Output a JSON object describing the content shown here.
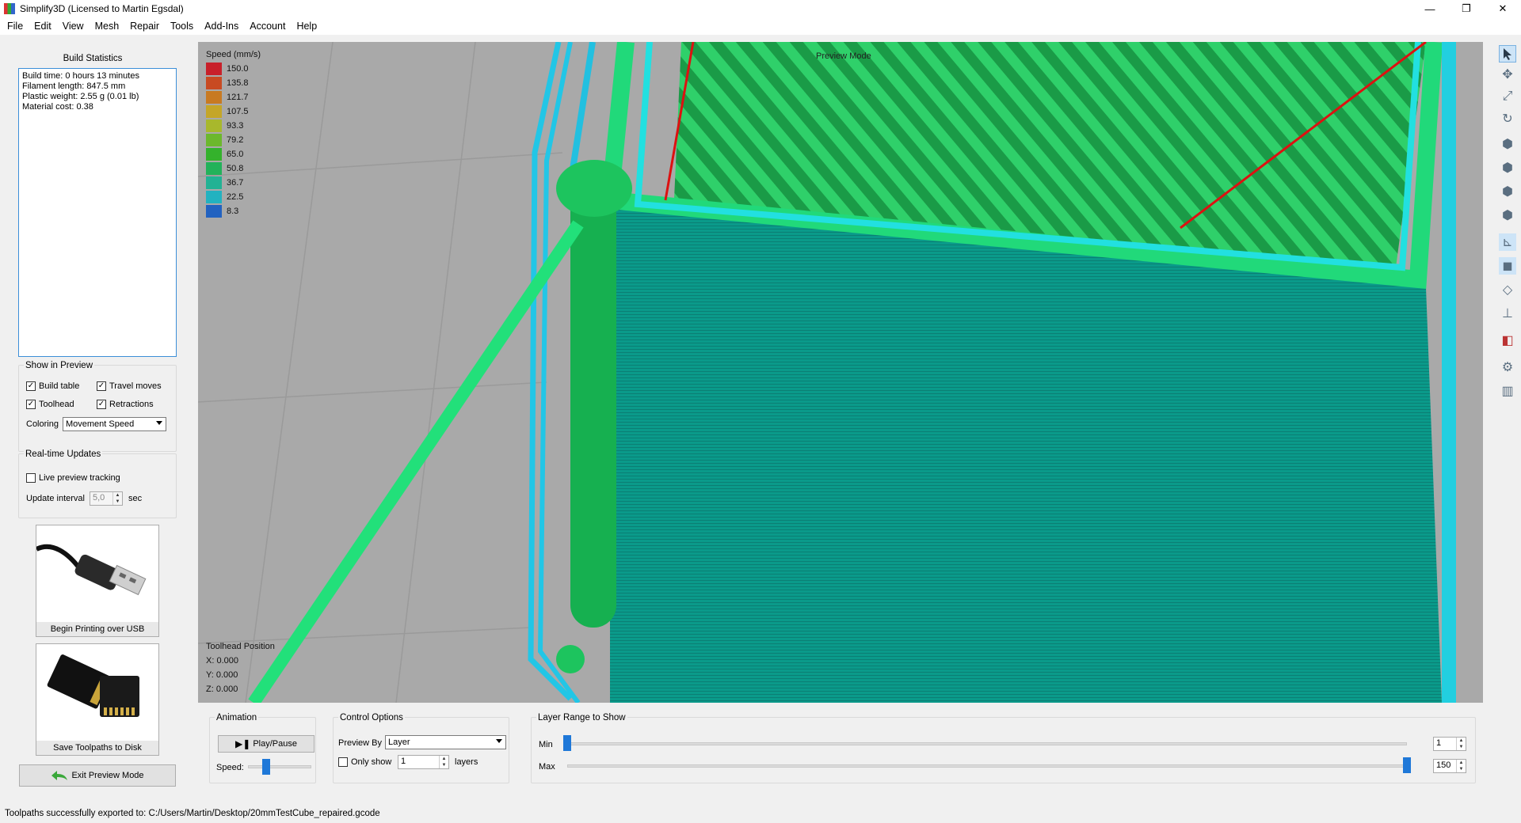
{
  "window": {
    "title": "Simplify3D (Licensed to Martin Egsdal)",
    "minimize_glyph": "—",
    "restore_glyph": "❐",
    "close_glyph": "✕"
  },
  "menu": [
    "File",
    "Edit",
    "View",
    "Mesh",
    "Repair",
    "Tools",
    "Add-Ins",
    "Account",
    "Help"
  ],
  "build_stats": {
    "title": "Build Statistics",
    "lines": [
      "Build time: 0 hours 13 minutes",
      "Filament length: 847.5 mm",
      "Plastic weight: 2.55 g (0.01 lb)",
      "Material cost: 0.38"
    ]
  },
  "show_in_preview": {
    "title": "Show in Preview",
    "build_table": "Build table",
    "build_table_checked": true,
    "travel_moves": "Travel moves",
    "travel_moves_checked": true,
    "toolhead": "Toolhead",
    "toolhead_checked": true,
    "retractions": "Retractions",
    "retractions_checked": true,
    "coloring_label": "Coloring",
    "coloring_value": "Movement Speed"
  },
  "realtime": {
    "title": "Real-time Updates",
    "live_tracking": "Live preview tracking",
    "live_tracking_checked": false,
    "interval_label": "Update interval",
    "interval_value": "5,0",
    "interval_unit": "sec"
  },
  "usb_button": "Begin Printing over USB",
  "save_button": "Save Toolpaths to Disk",
  "exit_button": "Exit Preview Mode",
  "viewport": {
    "legend_title": "Speed (mm/s)",
    "legend": [
      {
        "value": "150.0",
        "color": "#c8202a"
      },
      {
        "value": "135.8",
        "color": "#c84a22"
      },
      {
        "value": "121.7",
        "color": "#c87a22"
      },
      {
        "value": "107.5",
        "color": "#c4a628"
      },
      {
        "value": "93.3",
        "color": "#a8b82c"
      },
      {
        "value": "79.2",
        "color": "#6cb82c"
      },
      {
        "value": "65.0",
        "color": "#34b22c"
      },
      {
        "value": "50.8",
        "color": "#22b25a"
      },
      {
        "value": "36.7",
        "color": "#22b294"
      },
      {
        "value": "22.5",
        "color": "#22b2c0"
      },
      {
        "value": "8.3",
        "color": "#2262c0"
      }
    ],
    "mode_label": "Preview Mode",
    "toolhead_title": "Toolhead Position",
    "x": "X: 0.000",
    "y": "Y: 0.000",
    "z": "Z: 0.000"
  },
  "toolbar_icons": [
    "select-icon",
    "move-icon",
    "scale-icon",
    "rotate-icon",
    "view-front-icon",
    "view-top-icon",
    "view-left-icon",
    "view-right-icon",
    "axes-icon",
    "solid-cube-icon",
    "wireframe-cube-icon",
    "z-axis-icon",
    "cross-section-icon",
    "settings-gear-icon",
    "build-plate-icon"
  ],
  "animation": {
    "title": "Animation",
    "play_label": "Play/Pause",
    "speed_label": "Speed:",
    "speed_fraction": 0.25
  },
  "control_options": {
    "title": "Control Options",
    "preview_by_label": "Preview By",
    "preview_by_value": "Layer",
    "only_show_label": "Only show",
    "only_show_checked": false,
    "only_show_value": "1",
    "layers_label": "layers"
  },
  "layer_range": {
    "title": "Layer Range to Show",
    "min_label": "Min",
    "max_label": "Max",
    "min_value": "1",
    "max_value": "150",
    "min_fraction": 0.0,
    "max_fraction": 1.0
  },
  "status": "Toolpaths successfully exported to: C:/Users/Martin/Desktop/20mmTestCube_repaired.gcode"
}
